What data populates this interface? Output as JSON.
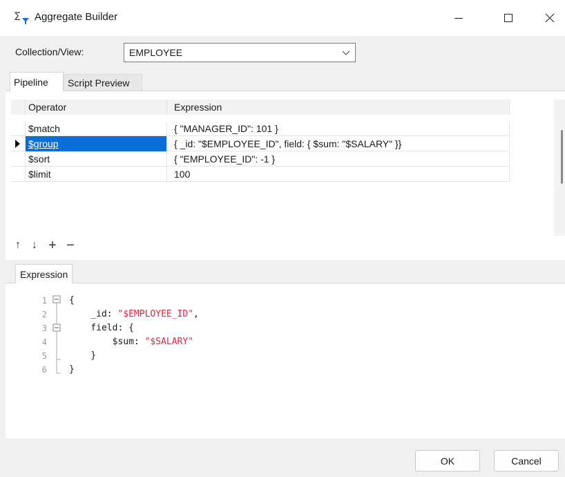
{
  "window": {
    "title": "Aggregate Builder",
    "minimize_icon": "minimize-icon",
    "maximize_icon": "maximize-icon",
    "close_icon": "close-icon"
  },
  "collection": {
    "label": "Collection/View:",
    "value": "EMPLOYEE"
  },
  "tabs": [
    {
      "label": "Pipeline",
      "active": true
    },
    {
      "label": "Script Preview",
      "active": false
    }
  ],
  "grid": {
    "headers": [
      "Operator",
      "Expression"
    ],
    "rows": [
      {
        "operator": "$match",
        "expression": "{     \"MANAGER_ID\": 101 }",
        "selected": false
      },
      {
        "operator": "$group",
        "expression": "{     _id: \"$EMPLOYEE_ID\",     field: {         $sum: \"$SALARY\"     }}",
        "selected": true
      },
      {
        "operator": "$sort",
        "expression": "{     \"EMPLOYEE_ID\": -1 }",
        "selected": false
      },
      {
        "operator": "$limit",
        "expression": "100",
        "selected": false
      }
    ]
  },
  "toolbar": {
    "move_up": "↑",
    "move_down": "↓",
    "add": "+",
    "remove": "−"
  },
  "expression_tab": "Expression",
  "code_lines": [
    {
      "n": "1",
      "parts": [
        {
          "t": "{",
          "s": false
        }
      ]
    },
    {
      "n": "2",
      "parts": [
        {
          "t": "    _id: ",
          "s": false
        },
        {
          "t": "\"$EMPLOYEE_ID\"",
          "s": true
        },
        {
          "t": ",",
          "s": false
        }
      ]
    },
    {
      "n": "3",
      "parts": [
        {
          "t": "    field: {",
          "s": false
        }
      ]
    },
    {
      "n": "4",
      "parts": [
        {
          "t": "        $sum: ",
          "s": false
        },
        {
          "t": "\"$SALARY\"",
          "s": true
        }
      ]
    },
    {
      "n": "5",
      "parts": [
        {
          "t": "    }",
          "s": false
        }
      ]
    },
    {
      "n": "6",
      "parts": [
        {
          "t": "}",
          "s": false
        }
      ]
    }
  ],
  "buttons": {
    "ok": "OK",
    "cancel": "Cancel"
  },
  "colors": {
    "selection": "#0a6fd6",
    "string": "#e0233d"
  }
}
